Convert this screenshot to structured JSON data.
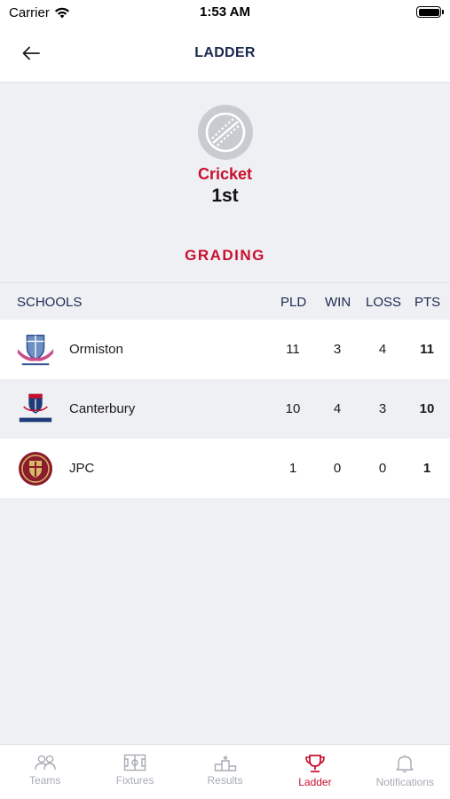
{
  "status_bar": {
    "carrier": "Carrier",
    "time": "1:53 AM"
  },
  "header": {
    "title": "LADDER"
  },
  "sport": {
    "name": "Cricket",
    "grade": "1st",
    "icon": "cricket-ball-icon"
  },
  "section": {
    "title": "GRADING"
  },
  "table": {
    "columns": {
      "school": "SCHOOLS",
      "played": "PLD",
      "won": "WIN",
      "lost": "LOSS",
      "points": "PTS"
    },
    "rows": [
      {
        "school": "Ormiston",
        "played": "11",
        "won": "3",
        "lost": "4",
        "points": "11",
        "logo": "ormiston-college-crest-icon"
      },
      {
        "school": "Canterbury",
        "played": "10",
        "won": "4",
        "lost": "3",
        "points": "10",
        "logo": "canterbury-crest-icon"
      },
      {
        "school": "JPC",
        "played": "1",
        "won": "0",
        "lost": "0",
        "points": "1",
        "logo": "jpc-seal-icon"
      }
    ]
  },
  "tab_bar": {
    "items": [
      {
        "label": "Teams",
        "icon": "people-icon",
        "active": false
      },
      {
        "label": "Fixtures",
        "icon": "field-icon",
        "active": false
      },
      {
        "label": "Results",
        "icon": "podium-icon",
        "active": false
      },
      {
        "label": "Ladder",
        "icon": "trophy-icon",
        "active": true
      },
      {
        "label": "Notifications",
        "icon": "bell-icon",
        "active": false
      }
    ]
  },
  "colors": {
    "accent": "#c8102e",
    "navy": "#1b2a4e",
    "background": "#eff0f4",
    "inactive": "#a7abb3"
  }
}
